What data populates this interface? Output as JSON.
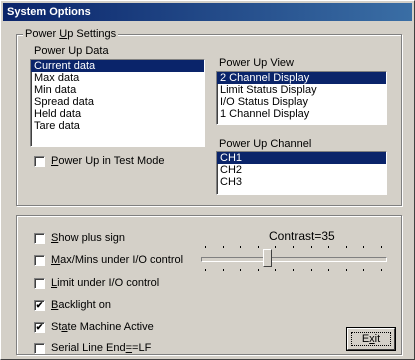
{
  "window": {
    "title": "System Options"
  },
  "power_up_settings": {
    "group_label_pre": "Power ",
    "group_label_u": "U",
    "group_label_post": "p Settings",
    "data": {
      "label": "Power Up Data",
      "items": [
        "Current data",
        "Max data",
        "Min data",
        "Spread data",
        "Held data",
        "Tare data"
      ],
      "selected": "Current data"
    },
    "view": {
      "label": "Power Up View",
      "items": [
        "2 Channel Display",
        "Limit Status Display",
        "I/O Status Display",
        "1 Channel Display"
      ],
      "selected": "2 Channel Display"
    },
    "channel": {
      "label": "Power Up Channel",
      "items": [
        "CH1",
        "CH2",
        "CH3"
      ],
      "selected": "CH1"
    },
    "test_mode": {
      "label_u": "P",
      "label_rest": "ower Up in Test Mode",
      "checked": false
    }
  },
  "options": {
    "show_plus": {
      "label_u": "S",
      "label_rest": "how plus sign",
      "checked": false
    },
    "maxmins": {
      "label_u": "M",
      "label_rest": "ax/Mins under I/O control",
      "checked": false
    },
    "limit": {
      "label_u": "L",
      "label_rest": "imit under I/O control",
      "checked": false
    },
    "backlight": {
      "label_u": "B",
      "label_rest": "acklight on",
      "checked": true
    },
    "state_machine": {
      "label_pre": "St",
      "label_u": "a",
      "label_rest": "te Machine Active",
      "checked": true
    },
    "serial": {
      "label_pre": "Serial Line End",
      "label_u": "=",
      "label_rest": "=LF",
      "checked": false
    }
  },
  "contrast": {
    "label": "Contrast=35",
    "value": 35,
    "min": 0,
    "max": 100
  },
  "exit_button": {
    "label_pre": "E",
    "label_u": "x",
    "label_rest": "it"
  },
  "icons": {
    "check": "✔"
  }
}
